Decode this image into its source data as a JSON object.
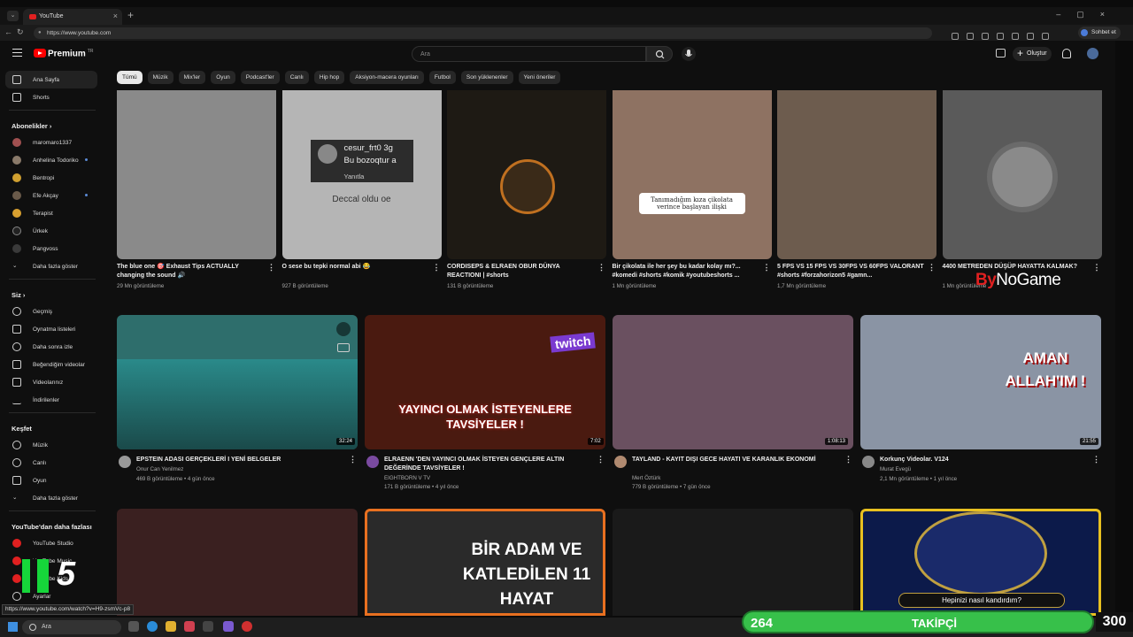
{
  "browser": {
    "tab_title": "YouTube",
    "url": "https://www.youtube.com",
    "chat_button": "Sohbet et",
    "status_url": "https://www.youtube.com/watch?v=H9-zsmVc-p8"
  },
  "header": {
    "brand": "Premium",
    "brand_sup": "TR",
    "search_placeholder": "Ara",
    "create_label": "Oluştur"
  },
  "chips": [
    "Tümü",
    "Müzik",
    "Mix'ler",
    "Oyun",
    "Podcast'ler",
    "Canlı",
    "Hip hop",
    "Aksiyon-macera oyunları",
    "Futbol",
    "Son yüklenenler",
    "Yeni öneriler"
  ],
  "sidebar": {
    "home": "Ana Sayfa",
    "shorts": "Shorts",
    "subs_head": "Abonelikler",
    "subs": [
      "maromaro1337",
      "Anhelina Todoriko",
      "Bentropi",
      "Efe Akçay",
      "Terapist",
      "Ürkek",
      "Pangvoss",
      "Daha fazla göster"
    ],
    "you_head": "Siz",
    "you": [
      "Geçmiş",
      "Oynatma listeleri",
      "Daha sonra izle",
      "Beğendiğim videolar",
      "Videolarınız",
      "İndirilenler"
    ],
    "explore_head": "Keşfet",
    "explore": [
      "Müzik",
      "Canlı",
      "Oyun",
      "Daha fazla göster"
    ],
    "more_head": "YouTube'dan daha fazlası",
    "more": [
      "YouTube Studio",
      "YouTube Music",
      "YouTube Kids"
    ],
    "settings": "Ayarlar"
  },
  "shorts": [
    {
      "title": "The blue one 🎯 Exhaust Tips ACTUALLY changing the sound 🔊",
      "views": "29 Mn görüntüleme",
      "color": "#8a8a8a"
    },
    {
      "title": "O sese bu tepki normal abi 😂",
      "views": "927 B görüntüleme",
      "overlay": "Deccal oldu oe",
      "comment_user": "cesur_frt0 3g",
      "comment_text": "Bu bozoqtur a",
      "comment_reply": "Yanıtla",
      "color": "#b5b5b5"
    },
    {
      "title": "CORDISEPS & ELRAEN OBUR DÜNYA REACTIONI | #shorts",
      "views": "131 B görüntüleme",
      "color": "#1e1a14"
    },
    {
      "title": "Bir çikolata ile her şey bu kadar kolay mı?... #komedi #shorts #komik #youtubeshorts ...",
      "views": "1 Mn görüntüleme",
      "overlay": "Tanımadığım kıza çikolata verince başlayan ilişki",
      "color": "#8e7262"
    },
    {
      "title": "5 FPS VS 15 FPS VS 30FPS VS 60FPS VALORANT #shorts #forzahorizon5 #gamn...",
      "views": "1,7 Mn görüntüleme",
      "color": "#6d5c4e"
    },
    {
      "title": "4400 METREDEN DÜŞÜP HAYATTA KALMAK?",
      "views": "1 Mn görüntüleme",
      "color": "#5a5a5a"
    }
  ],
  "videos": [
    {
      "title": "EPSTEIN ADASI GERÇEKLERİ I YENİ BELGELER",
      "channel": "Onur Can Yenilmez",
      "meta": "469 B görüntüleme • 4 gün önce",
      "duration": "32:24",
      "color": "#2e6e6c",
      "chan_color": "#999"
    },
    {
      "title": "ELRAENN 'DEN YAYINCI OLMAK İSTEYEN GENÇLERE ALTIN DEĞERİNDE TAVSİYELER !",
      "channel": "EIGHTBORN V TV",
      "meta": "171 B görüntüleme • 4 yıl önce",
      "duration": "7:02",
      "overlay": "YAYINCI OLMAK İSTEYENLERE TAVSİYELER !",
      "badge": "twitch",
      "color": "#4a1a10",
      "chan_color": "#7a4aa0"
    },
    {
      "title": "TAYLAND - KAYIT DIŞI GECE HAYATI VE KARANLIK EKONOMİ",
      "channel": "Mert Öztürk",
      "meta": "779 B görüntüleme • 7 gün önce",
      "duration": "1:08:13",
      "color": "#6a5060",
      "chan_color": "#b08a70"
    },
    {
      "title": "Korkunç Videolar. V124",
      "channel": "Murat Evegü",
      "meta": "2,1 Mn görüntüleme • 1 yıl önce",
      "duration": "21:55",
      "overlay": "AMAN ALLAH'IM !",
      "color": "#8a94a4",
      "chan_color": "#888"
    }
  ],
  "row3": [
    {
      "overlay": "",
      "color": "#3a2020"
    },
    {
      "overlay": "BİR ADAM VE KATLEDİLEN 11 HAYAT",
      "color": "#2a2a2a"
    },
    {
      "overlay": "",
      "color": "#1a1a1a"
    },
    {
      "overlay": "Hepinizi nasıl kandırdım?",
      "color": "#0c1a4a"
    }
  ],
  "overlay_stream": {
    "follow_count": "264",
    "follow_label": "TAKİPÇİ",
    "follow_goal": "300",
    "watermark_a": "By",
    "watermark_b": "NoGame",
    "k5_num": "5"
  },
  "taskbar": {
    "search": "Ara"
  }
}
